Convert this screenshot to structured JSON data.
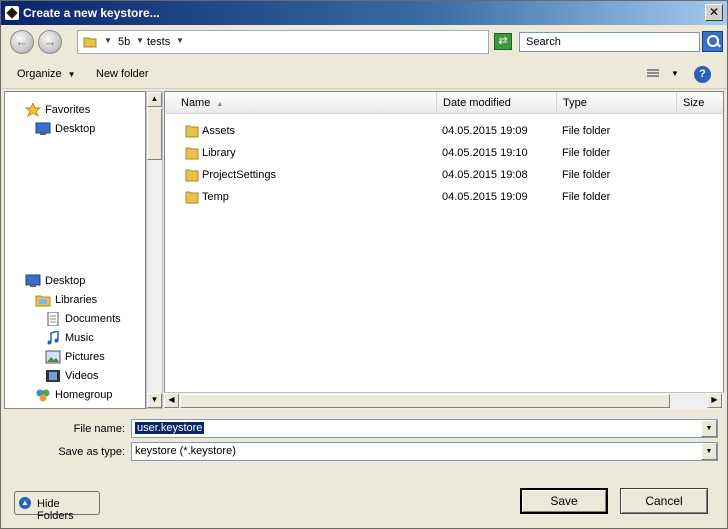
{
  "window": {
    "title": "Create a new keystore..."
  },
  "nav": {
    "breadcrumb": [
      "5b",
      "tests"
    ],
    "search_placeholder": "Search"
  },
  "toolbar": {
    "organize": "Organize",
    "new_folder": "New folder"
  },
  "sidebar": {
    "items": [
      {
        "label": "Favorites",
        "icon": "star-icon"
      },
      {
        "label": "Desktop",
        "icon": "desktop-icon"
      },
      {
        "label": "Desktop",
        "icon": "desktop-icon"
      },
      {
        "label": "Libraries",
        "icon": "libraries-icon"
      },
      {
        "label": "Documents",
        "icon": "documents-icon"
      },
      {
        "label": "Music",
        "icon": "music-icon"
      },
      {
        "label": "Pictures",
        "icon": "pictures-icon"
      },
      {
        "label": "Videos",
        "icon": "videos-icon"
      },
      {
        "label": "Homegroup",
        "icon": "homegroup-icon"
      }
    ]
  },
  "files": {
    "columns": [
      "Name",
      "Date modified",
      "Type",
      "Size"
    ],
    "rows": [
      {
        "name": "Assets",
        "date": "04.05.2015 19:09",
        "type": "File folder"
      },
      {
        "name": "Library",
        "date": "04.05.2015 19:10",
        "type": "File folder"
      },
      {
        "name": "ProjectSettings",
        "date": "04.05.2015 19:08",
        "type": "File folder"
      },
      {
        "name": "Temp",
        "date": "04.05.2015 19:09",
        "type": "File folder"
      }
    ]
  },
  "form": {
    "file_name_label": "File name:",
    "file_name_value": "user.keystore",
    "save_type_label": "Save as type:",
    "save_type_value": "keystore (*.keystore)"
  },
  "buttons": {
    "hide_folders": "Hide Folders",
    "save": "Save",
    "cancel": "Cancel"
  },
  "colors": {
    "folder": "#e8c34a",
    "titlebar": "#0a246a",
    "selection": "#0a246a"
  }
}
